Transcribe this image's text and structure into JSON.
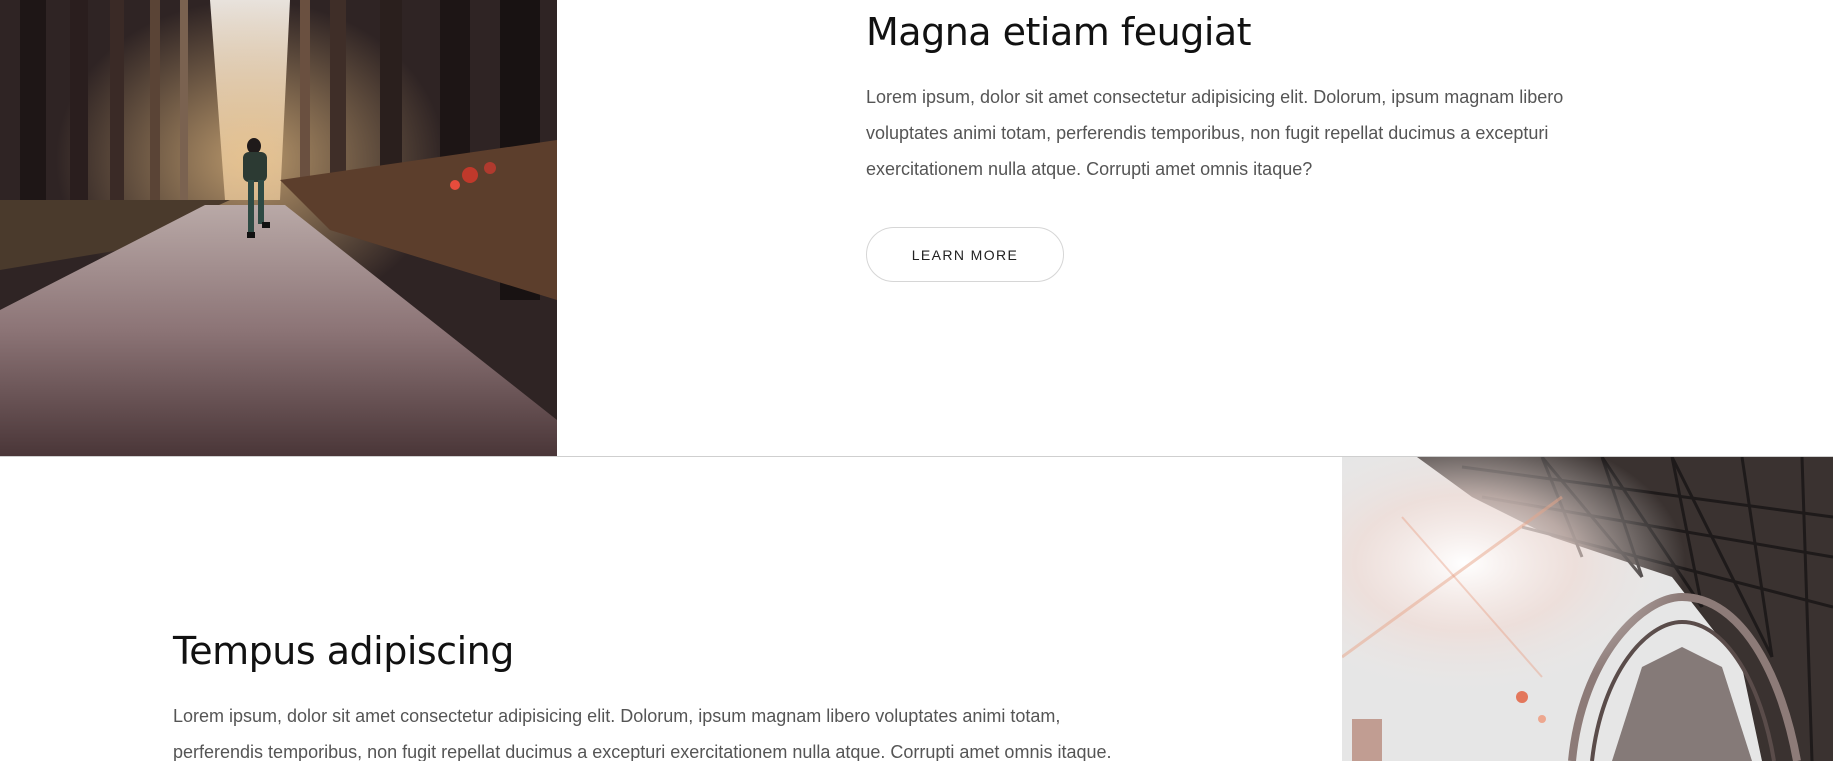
{
  "feature_1": {
    "heading": "Magna etiam feugiat",
    "body": "Lorem ipsum, dolor sit amet consectetur adipisicing elit. Dolorum, ipsum magnam libero voluptates animi totam, perferendis temporibus, non fugit repellat ducimus a excepturi exercitationem nulla atque. Corrupti amet omnis itaque?",
    "button_label": "LEARN MORE",
    "image": "forest-path-hiker-photo"
  },
  "feature_2": {
    "heading": "Tempus adipiscing",
    "body": "Lorem ipsum, dolor sit amet consectetur adipisicing elit. Dolorum, ipsum magnam libero voluptates animi totam, perferendis temporibus, non fugit repellat ducimus a excepturi exercitationem nulla atque. Corrupti amet omnis itaque.",
    "image": "steel-bridge-photo"
  }
}
